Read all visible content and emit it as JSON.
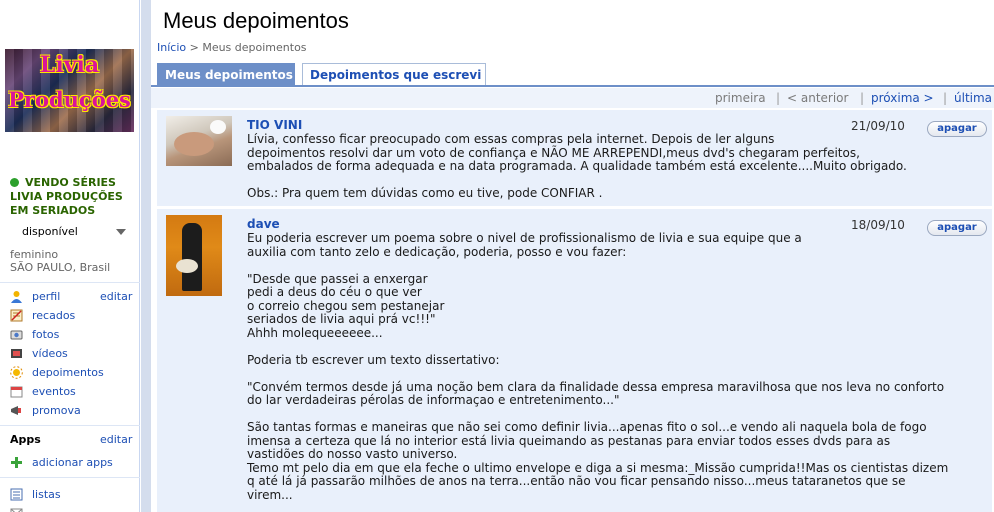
{
  "sidebar": {
    "photo_text": [
      "Livia",
      "Produções"
    ],
    "name": "VENDO SÉRIES LIVIA PRODUÇÕES EM SERIADOS",
    "status": "disponível",
    "gender": "feminino",
    "location": "SÃO PAULO, Brasil",
    "nav": [
      {
        "label": "perfil",
        "icon": "user-icon",
        "edit": "editar"
      },
      {
        "label": "recados",
        "icon": "notepad-icon"
      },
      {
        "label": "fotos",
        "icon": "camera-icon"
      },
      {
        "label": "vídeos",
        "icon": "film-icon"
      },
      {
        "label": "depoimentos",
        "icon": "sun-icon"
      },
      {
        "label": "eventos",
        "icon": "calendar-icon"
      },
      {
        "label": "promova",
        "icon": "megaphone-icon"
      }
    ],
    "apps": {
      "title": "Apps",
      "edit": "editar",
      "add_label": "adicionar apps",
      "add_icon": "plus-icon"
    },
    "lists_label": "listas",
    "lists_icon": "list-icon",
    "colors": {
      "status_online": "#2ca02c",
      "name": "#2a6400",
      "link": "#1d4fb4"
    }
  },
  "header": {
    "title": "Meus depoimentos",
    "breadcrumb": {
      "home": "Início",
      "sep": ">",
      "current": "Meus depoimentos"
    }
  },
  "tabs": [
    {
      "label": "Meus depoimentos",
      "active": true
    },
    {
      "label": "Depoimentos que escrevi",
      "active": false
    }
  ],
  "pager": {
    "first": "primeira",
    "prev": "< anterior",
    "next": "próxima >",
    "last": "última",
    "sep": "|"
  },
  "testimonials": [
    {
      "author": "TIO VINI",
      "date": "21/09/10",
      "delete_label": "apagar",
      "text": "Lívia, confesso ficar preocupado com essas compras pela internet. Depois de ler alguns\ndepoimentos resolvi dar um voto de confiança e NÃO ME ARREPENDI,meus dvd's chegaram perfeitos,\nembalados de forma adequada e na data programada. A qualidade também está excelente....Muito obrigado.\n\nObs.: Pra quem tem dúvidas como eu tive, pode CONFIAR ."
    },
    {
      "author": "dave",
      "date": "18/09/10",
      "delete_label": "apagar",
      "text": "Eu poderia escrever um poema sobre o nivel de profissionalismo de livia e sua equipe que a\nauxilia com tanto zelo e dedicação, poderia, posso e vou fazer:\n\n\"Desde que passei a enxergar\npedi a deus do céu o que ver\no correio chegou sem pestanejar\nseriados de livia aqui prá vc!!!\"\nAhhh molequeeeeee...\n\nPoderia tb escrever um texto dissertativo:\n\n\"Convém termos desde já uma noção bem clara da finalidade dessa empresa maravilhosa que nos leva no conforto\ndo lar verdadeiras pérolas de informaçao e entretenimento...\"\n\nSão tantas formas e maneiras que não sei como definir livia...apenas fito o sol...e vendo ali naquela bola de fogo\nimensa a certeza que lá no interior está livia queimando as pestanas para enviar todos esses dvds para as\nvastidões do nosso vasto universo.\nTemo mt pelo dia em que ela feche o ultimo envelope e diga a si mesma:_Missão cumprida!!Mas os cientistas dizem\nq até lá já passarão milhões de anos na terra...então não vou ficar pensando nisso...meus tataranetos que se\nvirem..."
    }
  ]
}
